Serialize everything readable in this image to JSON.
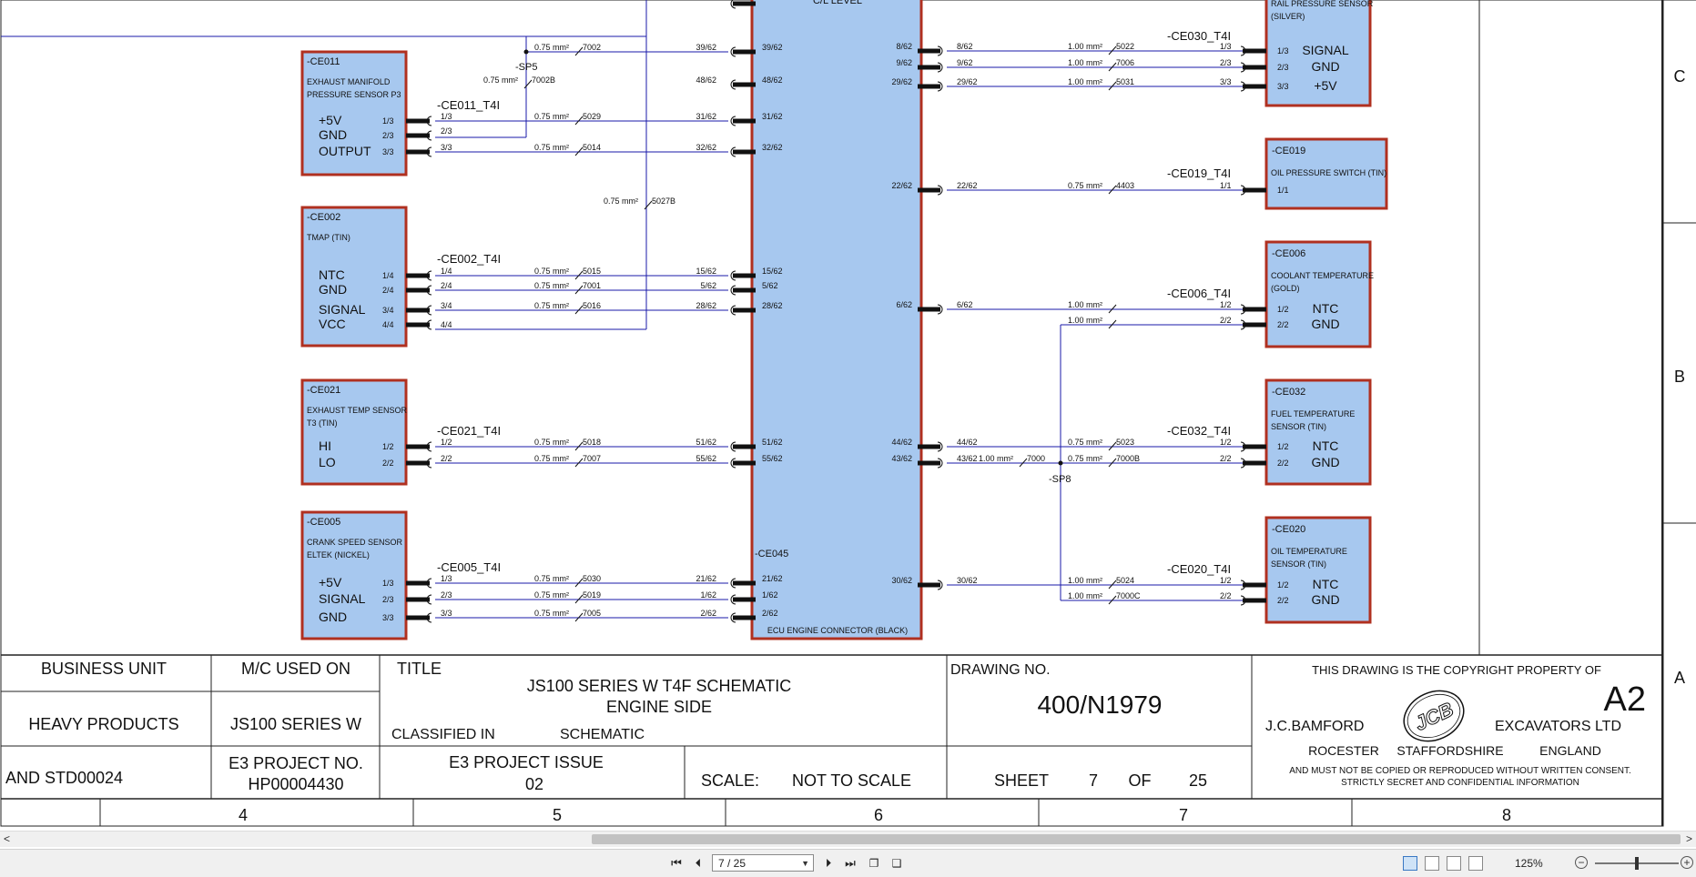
{
  "components": [
    {
      "id": "-CE011",
      "desc1": "EXHAUST MANIFOLD",
      "desc2": "PRESSURE SENSOR P3",
      "pins": [
        {
          "label": "+5V",
          "num": "1/3"
        },
        {
          "label": "GND",
          "num": "2/3"
        },
        {
          "label": "OUTPUT",
          "num": "3/3"
        }
      ]
    },
    {
      "id": "-CE002",
      "desc1": "TMAP (TIN)",
      "desc2": "",
      "pins": [
        {
          "label": "NTC",
          "num": "1/4"
        },
        {
          "label": "GND",
          "num": "2/4"
        },
        {
          "label": "SIGNAL",
          "num": "3/4"
        },
        {
          "label": "VCC",
          "num": "4/4"
        }
      ]
    },
    {
      "id": "-CE021",
      "desc1": "EXHAUST TEMP SENSOR",
      "desc2": "T3 (TIN)",
      "pins": [
        {
          "label": "HI",
          "num": "1/2"
        },
        {
          "label": "LO",
          "num": "2/2"
        }
      ]
    },
    {
      "id": "-CE005",
      "desc1": "CRANK SPEED SENSOR",
      "desc2": "ELTEK (NICKEL)",
      "pins": [
        {
          "label": "+5V",
          "num": "1/3"
        },
        {
          "label": "SIGNAL",
          "num": "2/3"
        },
        {
          "label": "GND",
          "num": "3/3"
        }
      ]
    },
    {
      "id": "",
      "desc1": "RAIL PRESSURE SENSOR",
      "desc2": "(SILVER)",
      "pins": [
        {
          "label": "SIGNAL",
          "num": "1/3"
        },
        {
          "label": "GND",
          "num": "2/3"
        },
        {
          "label": "+5V",
          "num": "3/3"
        }
      ]
    },
    {
      "id": "-CE019",
      "desc1": "OIL PRESSURE SWITCH (TIN)",
      "desc2": "",
      "pins": [
        {
          "label": "",
          "num": "1/1"
        }
      ]
    },
    {
      "id": "-CE006",
      "desc1": "COOLANT TEMPERATURE",
      "desc2": "(GOLD)",
      "pins": [
        {
          "label": "NTC",
          "num": "1/2"
        },
        {
          "label": "GND",
          "num": "2/2"
        }
      ]
    },
    {
      "id": "-CE032",
      "desc1": "FUEL TEMPERATURE",
      "desc2": "SENSOR (TIN)",
      "pins": [
        {
          "label": "NTC",
          "num": "1/2"
        },
        {
          "label": "GND",
          "num": "2/2"
        }
      ]
    },
    {
      "id": "-CE020",
      "desc1": "OIL TEMPERATURE",
      "desc2": "SENSOR (TIN)",
      "pins": [
        {
          "label": "NTC",
          "num": "1/2"
        },
        {
          "label": "GND",
          "num": "2/2"
        }
      ]
    }
  ],
  "harness_tags": [
    "-CE011_T4I",
    "-CE002_T4I",
    "-CE021_T4I",
    "-CE005_T4I",
    "-CE030_T4I",
    "-CE019_T4I",
    "-CE006_T4I",
    "-CE032_T4I",
    "-CE020_T4I"
  ],
  "ecu": {
    "id": "-CE045",
    "label": "ECU ENGINE CONNECTOR (BLACK)",
    "top_label": "C/L LEVEL"
  },
  "splices": [
    "-SP5",
    "-SP8"
  ],
  "left_wires": [
    {
      "src": "1/3",
      "spec": "0.75 mm²",
      "wire": "5029",
      "ecu_pin": "31/62"
    },
    {
      "src": "3/3",
      "spec": "0.75 mm²",
      "wire": "5014",
      "ecu_pin": "32/62"
    },
    {
      "src": "1/4",
      "spec": "0.75 mm²",
      "wire": "5015",
      "ecu_pin": "15/62"
    },
    {
      "src": "2/4",
      "spec": "0.75 mm²",
      "wire": "7001",
      "ecu_pin": "5/62"
    },
    {
      "src": "3/4",
      "spec": "0.75 mm²",
      "wire": "5016",
      "ecu_pin": "28/62"
    },
    {
      "src": "1/2",
      "spec": "0.75 mm²",
      "wire": "5018",
      "ecu_pin": "51/62"
    },
    {
      "src": "2/2",
      "spec": "0.75 mm²",
      "wire": "7007",
      "ecu_pin": "55/62"
    },
    {
      "src": "1/3",
      "spec": "0.75 mm²",
      "wire": "5030",
      "ecu_pin": "21/62"
    },
    {
      "src": "2/3",
      "spec": "0.75 mm²",
      "wire": "5019",
      "ecu_pin": "1/62"
    },
    {
      "src": "3/3",
      "spec": "0.75 mm²",
      "wire": "7005",
      "ecu_pin": "2/62"
    }
  ],
  "sp5_wires": [
    {
      "spec": "0.75 mm²",
      "wire": "7002",
      "ecu_pin": "39/62"
    },
    {
      "spec": "0.75 mm²",
      "wire": "7002B"
    },
    {
      "spec": "0.75 mm²",
      "wire": "5027B"
    }
  ],
  "ecu_left_unused": [
    "48/62"
  ],
  "right_wires": [
    {
      "ecu_pin": "8/62",
      "spec": "1.00 mm²",
      "wire": "5022",
      "dst": "1/3"
    },
    {
      "ecu_pin": "9/62",
      "spec": "1.00 mm²",
      "wire": "7006",
      "dst": "2/3"
    },
    {
      "ecu_pin": "29/62",
      "spec": "1.00 mm²",
      "wire": "5031",
      "dst": "3/3"
    },
    {
      "ecu_pin": "22/62",
      "spec": "0.75 mm²",
      "wire": "4403",
      "dst": "1/1"
    },
    {
      "ecu_pin": "6/62",
      "spec": "1.00 mm²",
      "wire": "",
      "dst": "1/2"
    },
    {
      "ecu_pin": "",
      "spec": "1.00 mm²",
      "wire": "",
      "dst": "2/2"
    },
    {
      "ecu_pin": "44/62",
      "spec": "0.75 mm²",
      "wire": "5023",
      "dst": "1/2"
    },
    {
      "ecu_pin": "43/62",
      "spec": "0.75 mm²",
      "wire": "7000B",
      "dst": "2/2"
    },
    {
      "ecu_pin": "30/62",
      "spec": "1.00 mm²",
      "wire": "5024",
      "dst": "1/2"
    },
    {
      "ecu_pin": "",
      "spec": "1.00 mm²",
      "wire": "7000C",
      "dst": "2/2"
    }
  ],
  "sp8_wire": {
    "spec": "1.00 mm²",
    "wire": "7000"
  },
  "title_block": {
    "business_unit_label": "BUSINESS UNIT",
    "business_unit": "HEAVY PRODUCTS",
    "standard": "AND STD00024",
    "mc_used_on_label": "M/C USED ON",
    "mc_used_on": "JS100 SERIES W",
    "e3_project_no_label": "E3 PROJECT NO.",
    "e3_project_no": "HP00004430",
    "title_label": "TITLE",
    "title_line1": "JS100 SERIES W T4F SCHEMATIC",
    "title_line2": "ENGINE SIDE",
    "classified_label": "CLASSIFIED IN",
    "classified": "SCHEMATIC",
    "e3_issue_label": "E3 PROJECT ISSUE",
    "e3_issue": "02",
    "scale_label": "SCALE:",
    "scale": "NOT TO SCALE",
    "drawing_no_label": "DRAWING NO.",
    "drawing_no": "400/N1979",
    "sheet_label": "SHEET",
    "sheet": "7",
    "of_label": "OF",
    "sheet_total": "25",
    "copyright_line": "THIS DRAWING IS THE COPYRIGHT PROPERTY OF",
    "size": "A2",
    "company_left": "J.C.BAMFORD",
    "company_right": "EXCAVATORS LTD",
    "address1": "ROCESTER",
    "address2": "STAFFORDSHIRE",
    "address3": "ENGLAND",
    "notice1": "AND MUST NOT BE COPIED OR REPRODUCED WITHOUT WRITTEN CONSENT.",
    "notice2": "STRICTLY SECRET AND CONFIDENTIAL INFORMATION",
    "logo_text": "JCB"
  },
  "column_markers": [
    "4",
    "5",
    "6",
    "7",
    "8"
  ],
  "row_markers": [
    "C",
    "B",
    "A"
  ],
  "viewer": {
    "page_field": "7 / 25",
    "zoom": "125%",
    "icons": [
      "first-page-icon",
      "prev-page-icon",
      "next-page-icon",
      "last-page-icon",
      "fit-page-icon",
      "fit-width-icon"
    ]
  },
  "colors": {
    "wire": "#1a1aa8",
    "component_fill": "#a7c8ef",
    "component_border": "#b03020",
    "pin_bar": "#111111",
    "frame": "#222222"
  }
}
